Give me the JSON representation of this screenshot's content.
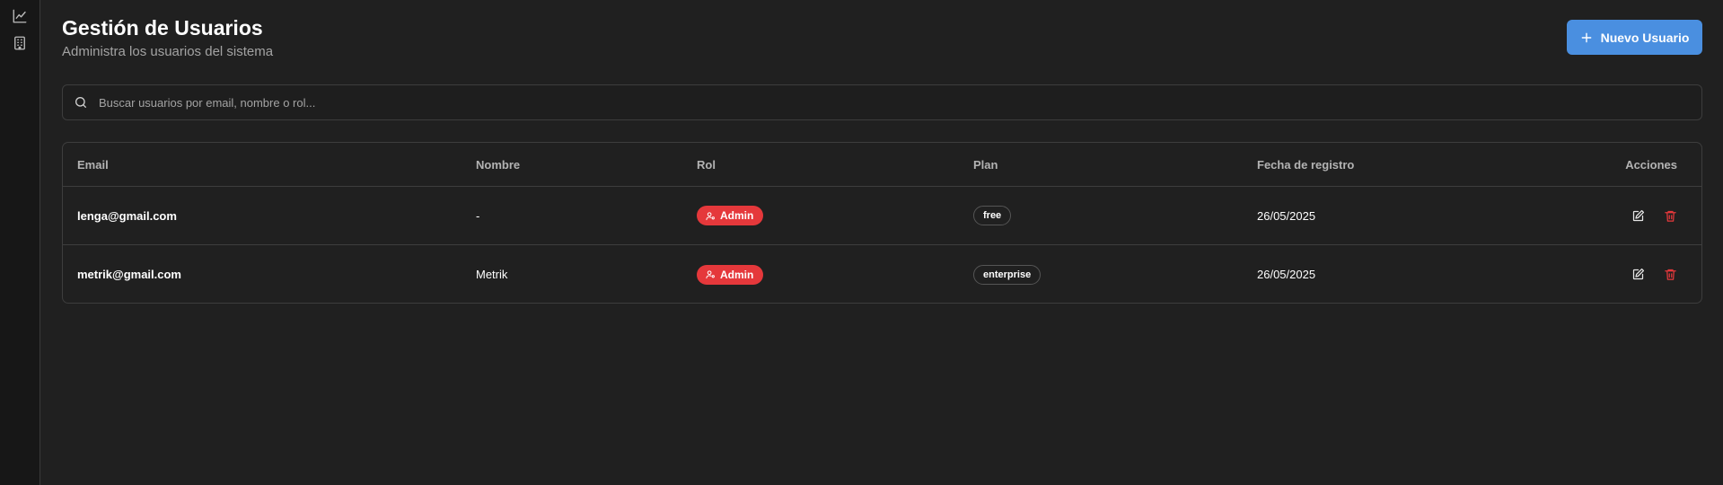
{
  "header": {
    "title": "Gestión de Usuarios",
    "subtitle": "Administra los usuarios del sistema",
    "new_user_label": "Nuevo Usuario"
  },
  "search": {
    "placeholder": "Buscar usuarios por email, nombre o rol..."
  },
  "sidebar": {
    "icons": [
      "chart-line-icon",
      "building-icon"
    ]
  },
  "table": {
    "columns": {
      "email": "Email",
      "name": "Nombre",
      "role": "Rol",
      "plan": "Plan",
      "date": "Fecha de registro",
      "actions": "Acciones"
    },
    "rows": [
      {
        "email": "lenga@gmail.com",
        "name": "-",
        "role": "Admin",
        "plan": "free",
        "date": "26/05/2025"
      },
      {
        "email": "metrik@gmail.com",
        "name": "Metrik",
        "role": "Admin",
        "plan": "enterprise",
        "date": "26/05/2025"
      }
    ]
  },
  "colors": {
    "background": "#202020",
    "accent_button": "#4a8fe0",
    "admin_badge": "#e5383b",
    "delete_icon": "#e5383b"
  }
}
